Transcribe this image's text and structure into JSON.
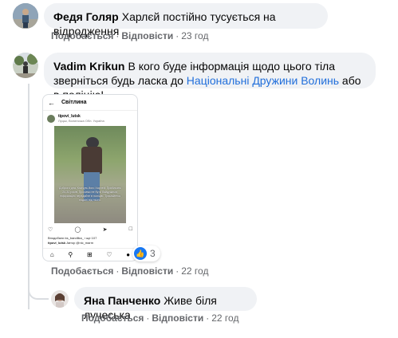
{
  "comments": [
    {
      "author": "Федя Голяр",
      "text": "Харлєй постійно тусується на відродження",
      "like_label": "Подобається",
      "reply_label": "Відповісти",
      "time": "23 год"
    },
    {
      "author": "Vadim Krikun",
      "text_before": "В кого буде інформація щодо цього тіла зверніться будь ласка до ",
      "mention": "Національні Дружини Волинь",
      "text_after": " або в поліцію!",
      "like_label": "Подобається",
      "reply_label": "Відповісти",
      "time": "22 год",
      "reaction_count": "3",
      "attachment": {
        "title": "Світлина",
        "username": "tipovi_lutsk",
        "location": "Луцьк, Волинська Обл. Україна",
        "caption": "Доброго дня. Кличуть його Харлей. Приблизно 25-30 років. Просимо не бути байдужими, інформацію передайте в поліцію. Тримайтеся подалі від нього.",
        "liked_by": "Вподобали ks_bandlika_ і ще 107",
        "desc_user": "tipovi_lutsk",
        "desc_text": "Автор @nic_marm"
      }
    },
    {
      "author": "Яна Панченко",
      "text": "Живе біля лучеська",
      "like_label": "Подобається",
      "reply_label": "Відповісти",
      "time": "22 год"
    }
  ],
  "colors": {
    "bubble": "#f0f2f5",
    "mention": "#216fdb",
    "meta": "#65676b",
    "like_blue": "#1877f2"
  }
}
